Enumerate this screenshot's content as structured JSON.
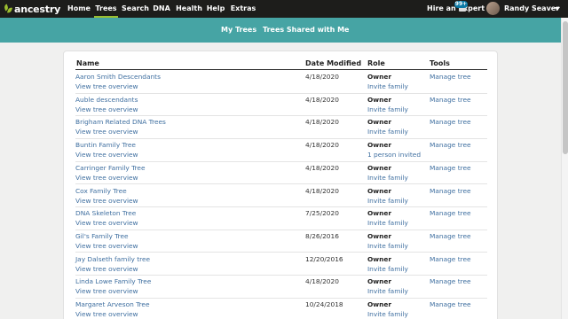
{
  "brand": {
    "logo_text": "ancestry",
    "accent_color": "#9cbe30",
    "teal_color": "#46a4a4"
  },
  "nav": {
    "items": [
      {
        "label": "Home",
        "active": false
      },
      {
        "label": "Trees",
        "active": true
      },
      {
        "label": "Search",
        "active": false
      },
      {
        "label": "DNA",
        "active": false
      },
      {
        "label": "Health",
        "active": false
      },
      {
        "label": "Help",
        "active": false
      },
      {
        "label": "Extras",
        "active": false
      }
    ],
    "hire_label": "Hire an Expert",
    "messages_badge": "99+",
    "messages_icon": "message-icon",
    "user_name": "Randy Seaver"
  },
  "subnav": {
    "tabs": [
      "My Trees",
      "Trees Shared with Me"
    ]
  },
  "table": {
    "headers": {
      "name": "Name",
      "date": "Date Modified",
      "role": "Role",
      "tools": "Tools"
    },
    "rows": [
      {
        "name": "Aaron Smith Descendants",
        "view": "View tree overview",
        "date": "4/18/2020",
        "role": "Owner",
        "invite": "Invite family",
        "tool": "Manage tree"
      },
      {
        "name": "Auble descendants",
        "view": "View tree overview",
        "date": "4/18/2020",
        "role": "Owner",
        "invite": "Invite family",
        "tool": "Manage tree"
      },
      {
        "name": "Brigham Related DNA Trees",
        "view": "View tree overview",
        "date": "4/18/2020",
        "role": "Owner",
        "invite": "Invite family",
        "tool": "Manage tree"
      },
      {
        "name": "Buntin Family Tree",
        "view": "View tree overview",
        "date": "4/18/2020",
        "role": "Owner",
        "invite": "1 person invited",
        "tool": "Manage tree"
      },
      {
        "name": "Carringer Family Tree",
        "view": "View tree overview",
        "date": "4/18/2020",
        "role": "Owner",
        "invite": "Invite family",
        "tool": "Manage tree"
      },
      {
        "name": "Cox Family Tree",
        "view": "View tree overview",
        "date": "4/18/2020",
        "role": "Owner",
        "invite": "Invite family",
        "tool": "Manage tree"
      },
      {
        "name": "DNA Skeleton Tree",
        "view": "View tree overview",
        "date": "7/25/2020",
        "role": "Owner",
        "invite": "Invite family",
        "tool": "Manage tree"
      },
      {
        "name": "Gil's Family Tree",
        "view": "View tree overview",
        "date": "8/26/2016",
        "role": "Owner",
        "invite": "Invite family",
        "tool": "Manage tree"
      },
      {
        "name": "Jay Dalseth family tree",
        "view": "View tree overview",
        "date": "12/20/2016",
        "role": "Owner",
        "invite": "Invite family",
        "tool": "Manage tree"
      },
      {
        "name": "Linda Lowe Family Tree",
        "view": "View tree overview",
        "date": "4/18/2020",
        "role": "Owner",
        "invite": "Invite family",
        "tool": "Manage tree"
      },
      {
        "name": "Margaret Arveson Tree",
        "view": "View tree overview",
        "date": "10/24/2018",
        "role": "Owner",
        "invite": "Invite family",
        "tool": "Manage tree"
      }
    ]
  }
}
